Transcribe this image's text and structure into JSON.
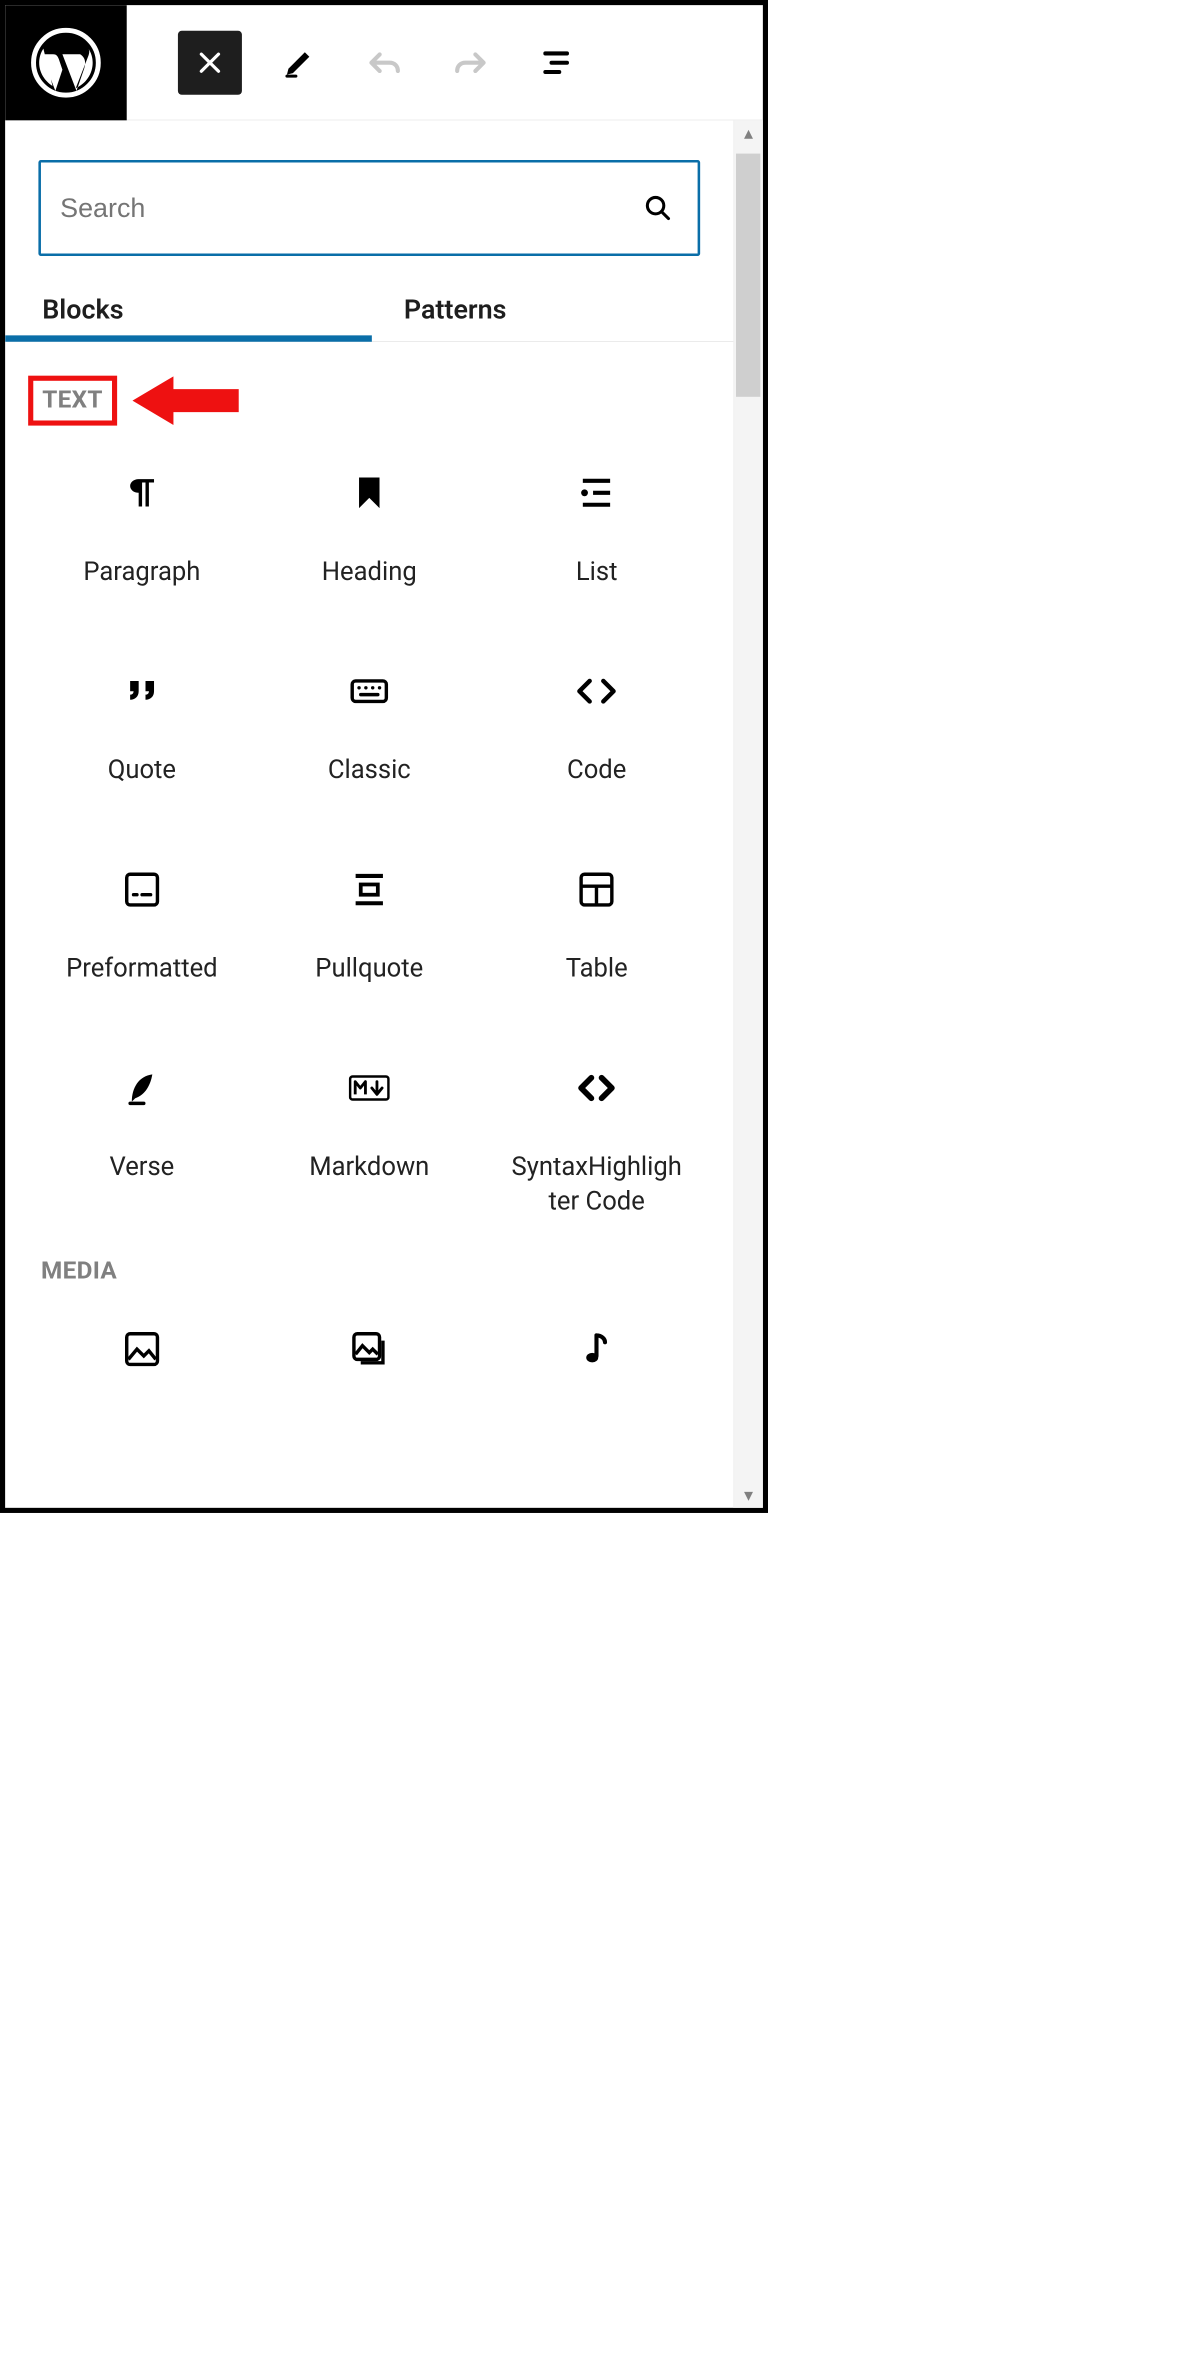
{
  "search": {
    "placeholder": "Search"
  },
  "tabs": {
    "blocks": "Blocks",
    "patterns": "Patterns"
  },
  "categories": {
    "text": "TEXT",
    "media": "MEDIA"
  },
  "text_blocks": [
    {
      "key": "paragraph",
      "label": "Paragraph"
    },
    {
      "key": "heading",
      "label": "Heading"
    },
    {
      "key": "list",
      "label": "List"
    },
    {
      "key": "quote",
      "label": "Quote"
    },
    {
      "key": "classic",
      "label": "Classic"
    },
    {
      "key": "code",
      "label": "Code"
    },
    {
      "key": "preformatted",
      "label": "Preformatted"
    },
    {
      "key": "pullquote",
      "label": "Pullquote"
    },
    {
      "key": "table",
      "label": "Table"
    },
    {
      "key": "verse",
      "label": "Verse"
    },
    {
      "key": "markdown",
      "label": "Markdown"
    },
    {
      "key": "syntax",
      "label": "SyntaxHighligh\nter Code"
    }
  ],
  "media_blocks": [
    {
      "key": "image",
      "label": ""
    },
    {
      "key": "gallery",
      "label": ""
    },
    {
      "key": "audio",
      "label": ""
    }
  ]
}
